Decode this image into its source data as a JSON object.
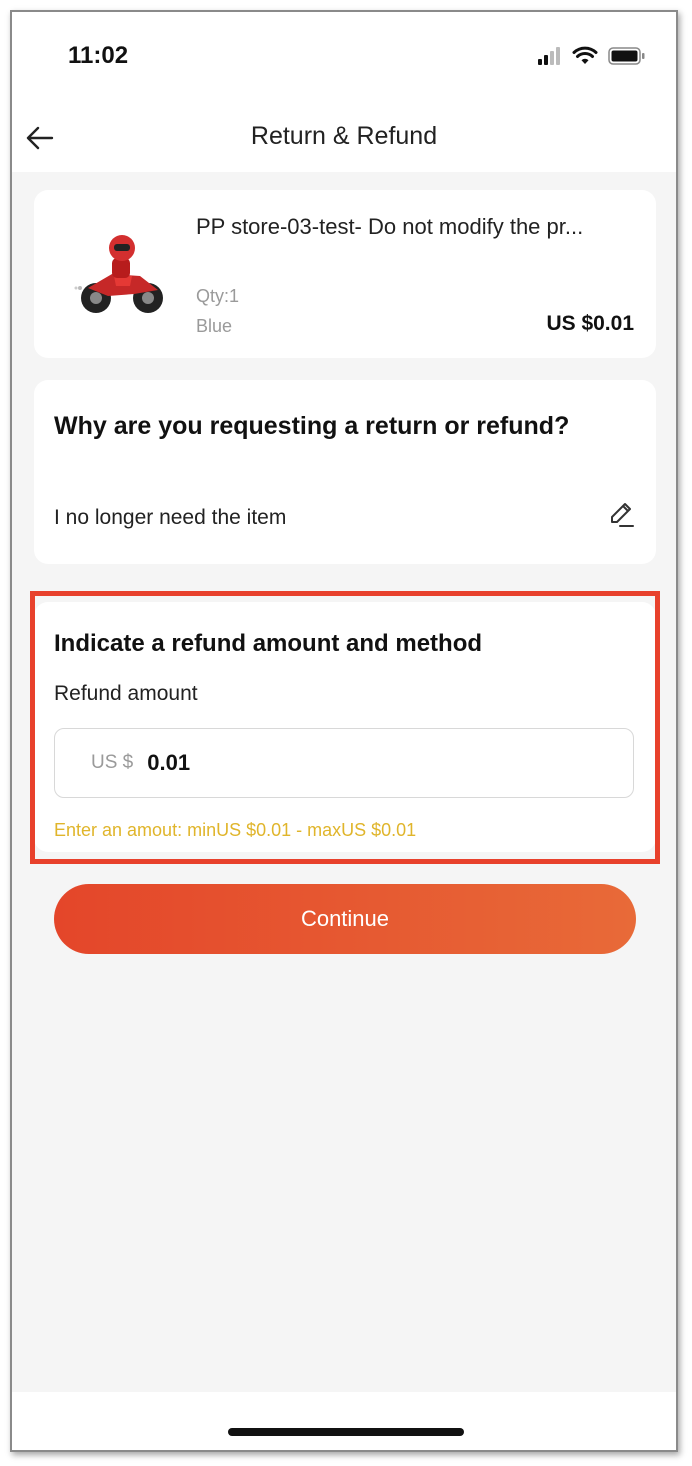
{
  "status_bar": {
    "time": "11:02"
  },
  "nav": {
    "title": "Return & Refund"
  },
  "product": {
    "title": "PP store-03-test- Do not modify the pr...",
    "qty": "Qty:1",
    "variant": "Blue",
    "price": "US $0.01"
  },
  "reason": {
    "heading": "Why are you requesting a return or refund?",
    "value": "I no longer need the item"
  },
  "refund": {
    "heading": "Indicate a refund amount and method",
    "amount_label": "Refund amount",
    "currency_prefix": "US $",
    "amount_value": "0.01",
    "hint": "Enter an amout: minUS $0.01 - maxUS $0.01"
  },
  "actions": {
    "continue_label": "Continue"
  },
  "colors": {
    "accent": "#e4462a",
    "highlight": "#e8412c",
    "hint": "#e0b52b"
  }
}
